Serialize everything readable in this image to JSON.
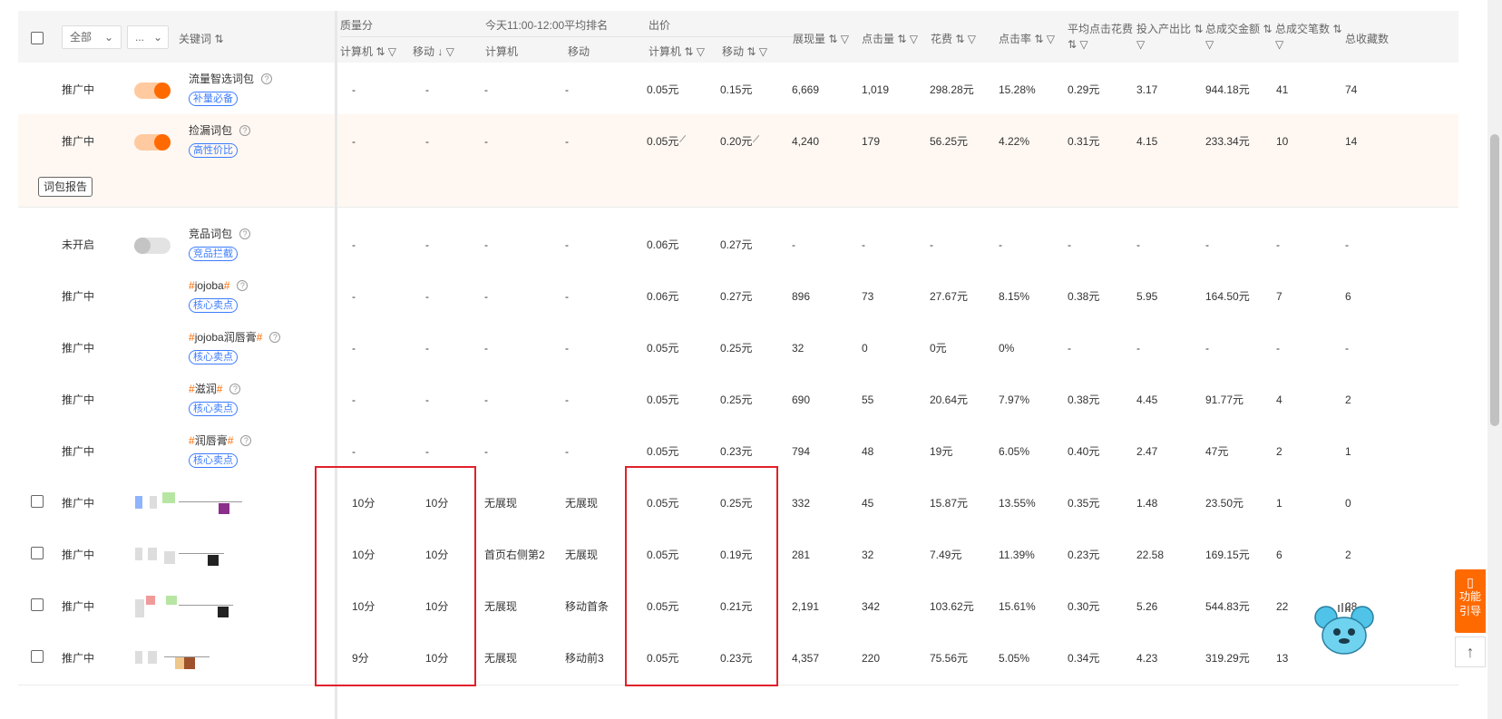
{
  "header": {
    "filter_all": "全部",
    "filter_more": "...",
    "col_keyword": "关键词",
    "group_quality": "质量分",
    "group_rank": "今天11:00-12:00平均排名",
    "group_bid": "出价",
    "sub_pc": "计算机",
    "sub_mobile": "移动",
    "col_impressions": "展现量",
    "col_clicks": "点击量",
    "col_cost": "花费",
    "col_ctr": "点击率",
    "col_avg_cpc": "平均点击花费",
    "col_roi": "投入产出比",
    "col_gmv": "总成交金额",
    "col_orders": "总成交笔数",
    "col_favorites": "总收藏数"
  },
  "report_button": "词包报告",
  "rows": [
    {
      "status": "推广中",
      "toggle": "on",
      "keyword": "流量智选词包",
      "tag": "补量必备",
      "q_pc": "-",
      "q_mobile": "-",
      "rank_pc": "-",
      "rank_mobile": "-",
      "bid_pc": "0.05元",
      "bid_mobile": "0.15元",
      "impressions": "6,669",
      "clicks": "1,019",
      "cost": "298.28元",
      "ctr": "15.28%",
      "cpc": "0.29元",
      "roi": "3.17",
      "gmv": "944.18元",
      "orders": "41",
      "favorites": "74"
    },
    {
      "status": "推广中",
      "toggle": "on",
      "keyword": "捡漏词包",
      "tag": "高性价比",
      "q_pc": "-",
      "q_mobile": "-",
      "rank_pc": "-",
      "rank_mobile": "-",
      "bid_pc": "0.05元",
      "bid_mobile": "0.20元",
      "impressions": "4,240",
      "clicks": "179",
      "cost": "56.25元",
      "ctr": "4.22%",
      "cpc": "0.31元",
      "roi": "4.15",
      "gmv": "233.34元",
      "orders": "10",
      "favorites": "14"
    },
    {
      "status": "未开启",
      "toggle": "off",
      "keyword": "竞品词包",
      "tag": "竞品拦截",
      "q_pc": "-",
      "q_mobile": "-",
      "rank_pc": "-",
      "rank_mobile": "-",
      "bid_pc": "0.06元",
      "bid_mobile": "0.27元",
      "impressions": "-",
      "clicks": "-",
      "cost": "-",
      "ctr": "-",
      "cpc": "-",
      "roi": "-",
      "gmv": "-",
      "orders": "-",
      "favorites": "-"
    },
    {
      "status": "推广中",
      "keyword": "jojoba",
      "tag": "核心卖点",
      "q_pc": "-",
      "q_mobile": "-",
      "rank_pc": "-",
      "rank_mobile": "-",
      "bid_pc": "0.06元",
      "bid_mobile": "0.27元",
      "impressions": "896",
      "clicks": "73",
      "cost": "27.67元",
      "ctr": "8.15%",
      "cpc": "0.38元",
      "roi": "5.95",
      "gmv": "164.50元",
      "orders": "7",
      "favorites": "6"
    },
    {
      "status": "推广中",
      "keyword": "jojoba润唇膏",
      "tag": "核心卖点",
      "q_pc": "-",
      "q_mobile": "-",
      "rank_pc": "-",
      "rank_mobile": "-",
      "bid_pc": "0.05元",
      "bid_mobile": "0.25元",
      "impressions": "32",
      "clicks": "0",
      "cost": "0元",
      "ctr": "0%",
      "cpc": "-",
      "roi": "-",
      "gmv": "-",
      "orders": "-",
      "favorites": "-"
    },
    {
      "status": "推广中",
      "keyword": "滋润",
      "tag": "核心卖点",
      "q_pc": "-",
      "q_mobile": "-",
      "rank_pc": "-",
      "rank_mobile": "-",
      "bid_pc": "0.05元",
      "bid_mobile": "0.25元",
      "impressions": "690",
      "clicks": "55",
      "cost": "20.64元",
      "ctr": "7.97%",
      "cpc": "0.38元",
      "roi": "4.45",
      "gmv": "91.77元",
      "orders": "4",
      "favorites": "2"
    },
    {
      "status": "推广中",
      "keyword": "润唇膏",
      "tag": "核心卖点",
      "q_pc": "-",
      "q_mobile": "-",
      "rank_pc": "-",
      "rank_mobile": "-",
      "bid_pc": "0.05元",
      "bid_mobile": "0.23元",
      "impressions": "794",
      "clicks": "48",
      "cost": "19元",
      "ctr": "6.05%",
      "cpc": "0.40元",
      "roi": "2.47",
      "gmv": "47元",
      "orders": "2",
      "favorites": "1"
    },
    {
      "status": "推广中",
      "q_pc": "10分",
      "q_mobile": "10分",
      "rank_pc": "无展现",
      "rank_mobile": "无展现",
      "bid_pc": "0.05元",
      "bid_mobile": "0.25元",
      "impressions": "332",
      "clicks": "45",
      "cost": "15.87元",
      "ctr": "13.55%",
      "cpc": "0.35元",
      "roi": "1.48",
      "gmv": "23.50元",
      "orders": "1",
      "favorites": "0"
    },
    {
      "status": "推广中",
      "q_pc": "10分",
      "q_mobile": "10分",
      "rank_pc": "首页右侧第2",
      "rank_mobile": "无展现",
      "bid_pc": "0.05元",
      "bid_mobile": "0.19元",
      "impressions": "281",
      "clicks": "32",
      "cost": "7.49元",
      "ctr": "11.39%",
      "cpc": "0.23元",
      "roi": "22.58",
      "gmv": "169.15元",
      "orders": "6",
      "favorites": "2"
    },
    {
      "status": "推广中",
      "q_pc": "10分",
      "q_mobile": "10分",
      "rank_pc": "无展现",
      "rank_mobile": "移动首条",
      "bid_pc": "0.05元",
      "bid_mobile": "0.21元",
      "impressions": "2,191",
      "clicks": "342",
      "cost": "103.62元",
      "ctr": "15.61%",
      "cpc": "0.30元",
      "roi": "5.26",
      "gmv": "544.83元",
      "orders": "22",
      "favorites": "28"
    },
    {
      "status": "推广中",
      "q_pc": "9分",
      "q_mobile": "10分",
      "rank_pc": "无展现",
      "rank_mobile": "移动前3",
      "bid_pc": "0.05元",
      "bid_mobile": "0.23元",
      "impressions": "4,357",
      "clicks": "220",
      "cost": "75.56元",
      "ctr": "5.05%",
      "cpc": "0.34元",
      "roi": "4.23",
      "gmv": "319.29元",
      "orders": "13",
      "favorites": ""
    }
  ],
  "side": {
    "guide_label": "功能\n引导",
    "guide_icon": "book-icon",
    "top_icon": "arrow-up-icon"
  },
  "colors": {
    "accent": "#ff6a00",
    "status_on": "#2f9e44",
    "tag_blue": "#3c7cff",
    "highlight_box": "#e0212a"
  }
}
